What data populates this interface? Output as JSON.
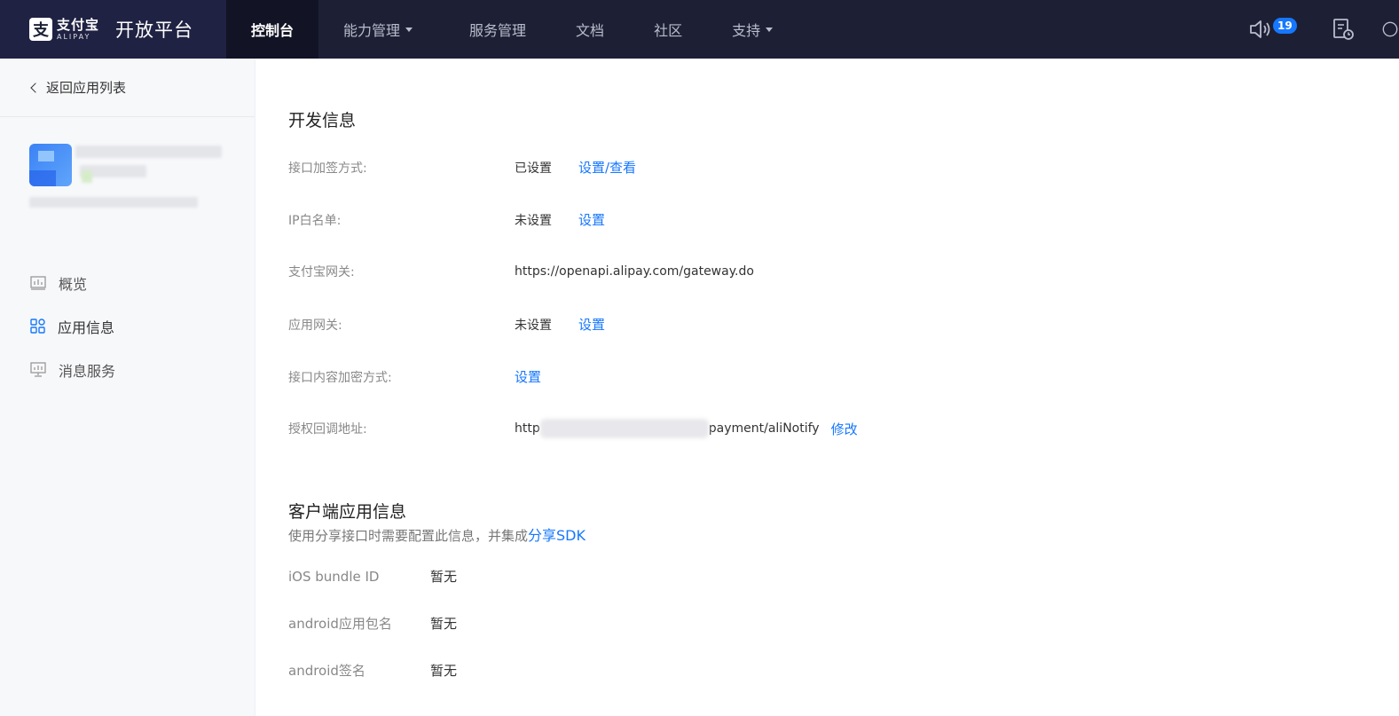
{
  "brand": {
    "logo_char": "支",
    "name_cn": "支付宝",
    "name_en": "ALIPAY",
    "platform": "开放平台"
  },
  "nav": {
    "items": [
      {
        "label": "控制台"
      },
      {
        "label": "能力管理"
      },
      {
        "label": "服务管理"
      },
      {
        "label": "文档"
      },
      {
        "label": "社区"
      },
      {
        "label": "支持"
      }
    ],
    "notification_count": "19"
  },
  "sidebar": {
    "back_label": "返回应用列表",
    "menu": [
      {
        "label": "概览",
        "icon": "bar-chart-icon"
      },
      {
        "label": "应用信息",
        "icon": "grid-icon"
      },
      {
        "label": "消息服务",
        "icon": "monitor-chart-icon"
      }
    ]
  },
  "dev_info": {
    "title": "开发信息",
    "rows": [
      {
        "label": "接口加签方式:",
        "value": "已设置",
        "link": "设置/查看"
      },
      {
        "label": "IP白名单:",
        "value": "未设置",
        "link": "设置"
      },
      {
        "label": "支付宝网关:",
        "value": "https://openapi.alipay.com/gateway.do",
        "link": ""
      },
      {
        "label": "应用网关:",
        "value": "未设置",
        "link": "设置"
      },
      {
        "label": "接口内容加密方式:",
        "value": "",
        "link": "设置"
      },
      {
        "label": "授权回调地址:",
        "value_prefix": "http",
        "value_suffix": "payment/aliNotify",
        "link": "修改"
      }
    ]
  },
  "client_info": {
    "title": "客户端应用信息",
    "desc": "使用分享接口时需要配置此信息，并集成",
    "desc_link": "分享SDK",
    "rows": [
      {
        "label": "iOS bundle ID",
        "value": "暂无"
      },
      {
        "label": "android应用包名",
        "value": "暂无"
      },
      {
        "label": "android签名",
        "value": "暂无"
      }
    ]
  },
  "colors": {
    "topbar": "#1d2035",
    "accent": "#1677ff",
    "sidebar_bg": "#f7f8fa"
  }
}
